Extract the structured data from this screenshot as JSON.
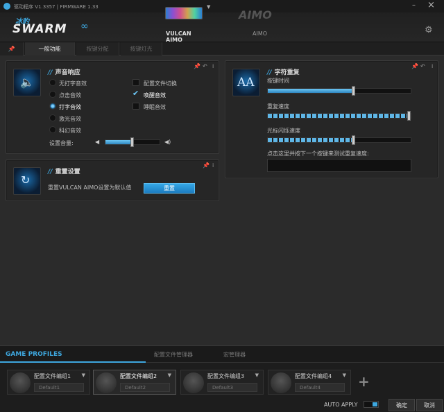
{
  "titlebar": {
    "driver": "驱动程序 V1.3357 | FIRMWARE 1.33",
    "minimize": "–",
    "close": "×"
  },
  "header": {
    "logo_cn": "冰豹",
    "logo_en": "SWARM",
    "devices": [
      {
        "label": "VULCAN AIMO"
      },
      {
        "label": "AIMO",
        "brand": "AIMO"
      }
    ]
  },
  "tabs": [
    {
      "label": "一般功能",
      "active": true
    },
    {
      "label": "按键分配",
      "active": false
    },
    {
      "label": "按键灯光",
      "active": false
    }
  ],
  "sound_panel": {
    "title": "声音响应",
    "options": [
      {
        "label": "无打字音效",
        "selected": false
      },
      {
        "label": "点击音效",
        "selected": false
      },
      {
        "label": "打字音效",
        "selected": true
      },
      {
        "label": "激光音效",
        "selected": false
      },
      {
        "label": "科幻音效",
        "selected": false
      }
    ],
    "checks": [
      {
        "label": "配置文件切换",
        "checked": false
      },
      {
        "label": "唤醒音效",
        "checked": true
      },
      {
        "label": "睡眠音效",
        "checked": false
      }
    ],
    "volume_label": "设置音量:",
    "volume_level": 0.5
  },
  "reset_panel": {
    "title": "重置设置",
    "text": "重置VULCAN AIMO设置为默认值",
    "button": "重置"
  },
  "char_panel": {
    "title": "字符重复",
    "delay_label": "按键时间",
    "delay_level": 0.6,
    "rate_label": "重复速度",
    "rate_level": 1.0,
    "cursor_label": "光标闪烁速度",
    "cursor_level": 0.6,
    "test_label": "点击这里并按下一个按键来测试重复速度:",
    "test_value": ""
  },
  "profiles": {
    "title": "GAME PROFILES",
    "tabs": [
      "配置文件管理器",
      "宏管理器"
    ],
    "slots": [
      {
        "name": "配置文件编组1",
        "default": "Default1"
      },
      {
        "name": "配置文件编组2",
        "default": "Default2"
      },
      {
        "name": "配置文件编组3",
        "default": "Default3"
      },
      {
        "name": "配置文件编组4",
        "default": "Default4"
      }
    ],
    "add": "+",
    "auto_apply": "AUTO APPLY",
    "ok": "确定",
    "cancel": "取消"
  },
  "colors": {
    "accent": "#3ea8e0",
    "bg": "#2b2b2b"
  }
}
